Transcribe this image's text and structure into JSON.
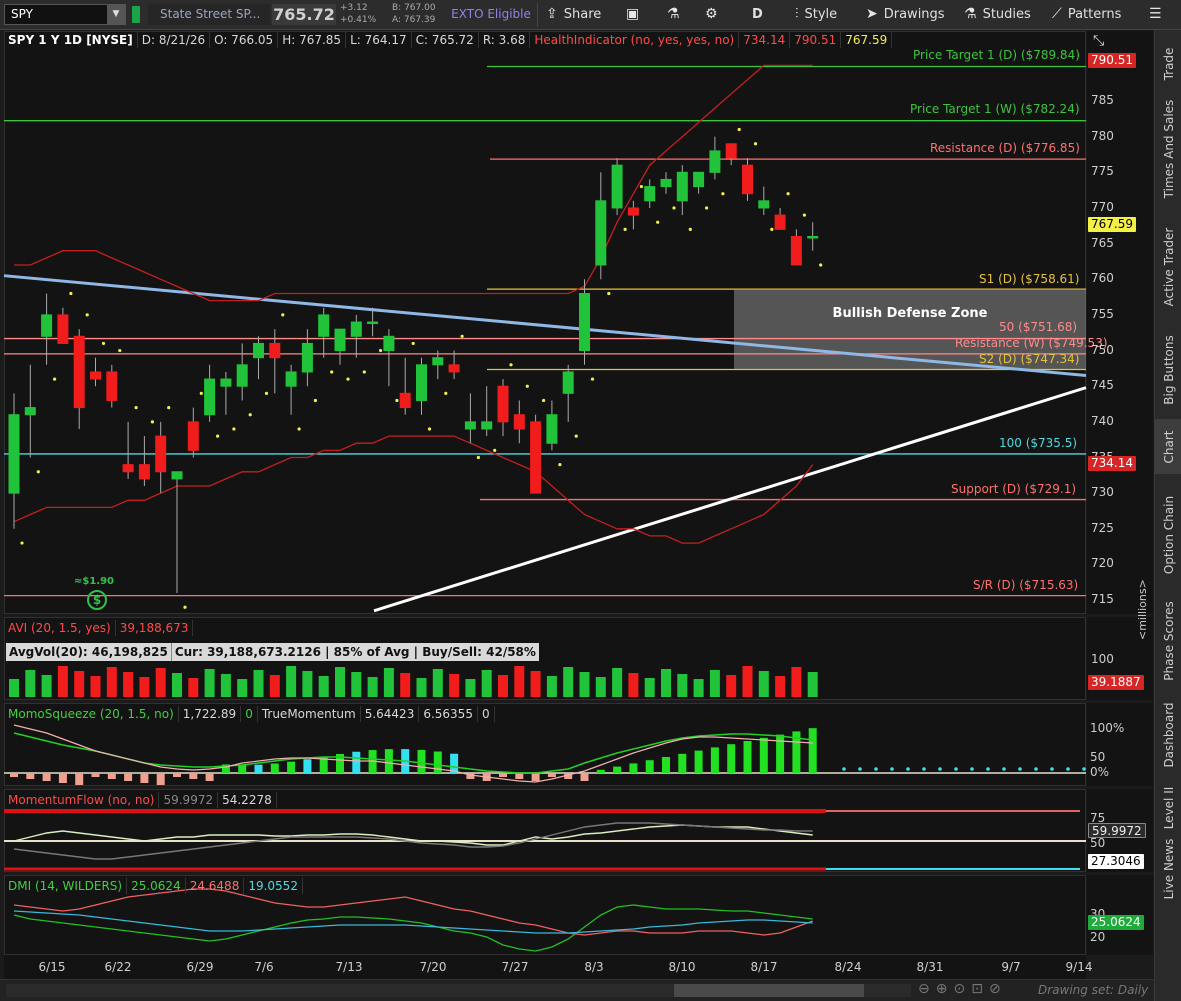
{
  "toolbar": {
    "symbol": "SPY",
    "name": "State Street SP...",
    "last": "765.72",
    "change": "+3.12",
    "change_pct": "+0.41%",
    "bid": "B: 767.00",
    "ask": "A: 767.39",
    "exto": "EXTO Eligible",
    "share": "Share",
    "timeframe": "D",
    "style": "Style",
    "drawings": "Drawings",
    "studies": "Studies",
    "patterns": "Patterns"
  },
  "header": {
    "title": "SPY 1 Y 1D [NYSE]",
    "date": "D: 8/21/26",
    "open": "O: 766.05",
    "high": "H: 767.85",
    "low": "L: 764.17",
    "close": "C: 765.72",
    "range": "R: 3.68",
    "health": "HealthIndicator (no, yes, yes, no)",
    "health_v1": "734.14",
    "health_v2": "790.51",
    "health_v3": "767.59"
  },
  "price_axis": [
    "785",
    "780",
    "775",
    "770",
    "765",
    "760",
    "755",
    "750",
    "745",
    "740",
    "735",
    "730",
    "725",
    "720",
    "715"
  ],
  "levels": {
    "pt_d": "Price Target 1 (D) ($789.84)",
    "pt_w": "Price Target 1 (W) ($782.24)",
    "res_d": "Resistance (D) ($776.85)",
    "s1_d": "S1 (D) ($758.61)",
    "defense": "Bullish Defense Zone",
    "fifty": "50 ($751.68)",
    "res_w": "Resistance (W) ($749.53)",
    "s2_d": "S2 (D) ($747.34)",
    "hundred": "100 ($735.5)",
    "sup_d": "Support (D) ($729.1)",
    "sr_d": "S/R (D) ($715.63)",
    "dividend": "≈$1.90",
    "dividend_icon": "$"
  },
  "badges": {
    "upper": "790.51",
    "last": "767.59",
    "lower": "734.14",
    "vol": "39.1887",
    "mf1": "59.9972",
    "mf2": "27.3046",
    "dmi": "25.0624"
  },
  "volume": {
    "study": "AVI (20, 1.5, yes)",
    "study_val": "39,188,673",
    "stats": "AvgVol(20): 46,198,825",
    "cur": "Cur: 39,188,673.2126 | 85% of Avg | Buy/Sell: 42/58%",
    "axis_100": "100",
    "unit": "<millions>"
  },
  "momo": {
    "study": "MomoSqueeze (20, 1.5, no)",
    "v1": "1,722.89",
    "v2": "0",
    "study2": "TrueMomentum",
    "v3": "5.64423",
    "v4": "6.56355",
    "v5": "0",
    "axis": [
      "100%",
      "50",
      "0%"
    ]
  },
  "mflow": {
    "study": "MomentumFlow (no, no)",
    "v1": "59.9972",
    "v2": "54.2278",
    "axis": [
      "75",
      "50"
    ]
  },
  "dmi": {
    "study": "DMI (14, WILDERS)",
    "v1": "25.0624",
    "v2": "24.6488",
    "v3": "19.0552",
    "axis": [
      "30",
      "20"
    ]
  },
  "dates": [
    "6/15",
    "6/22",
    "6/29",
    "7/6",
    "7/13",
    "7/20",
    "7/27",
    "8/3",
    "8/10",
    "8/17",
    "8/24",
    "8/31",
    "9/7",
    "9/14"
  ],
  "right_tabs": [
    "Trade",
    "Times And Sales",
    "Active Trader",
    "Big Buttons",
    "Chart",
    "Option Chain",
    "Phase Scores",
    "Dashboard",
    "Level II",
    "Live News"
  ],
  "footer": {
    "drawing_set": "Drawing set: Daily"
  },
  "candles": [
    {
      "d": "6/11",
      "o": 730,
      "h": 744,
      "l": 725,
      "c": 741
    },
    {
      "d": "6/12",
      "o": 741,
      "h": 748,
      "l": 735,
      "c": 742
    },
    {
      "d": "6/15",
      "o": 752,
      "h": 758,
      "l": 748,
      "c": 755
    },
    {
      "d": "6/16",
      "o": 755,
      "h": 756,
      "l": 751,
      "c": 751
    },
    {
      "d": "6/17",
      "o": 752,
      "h": 753,
      "l": 739,
      "c": 742
    },
    {
      "d": "6/18",
      "o": 747,
      "h": 749,
      "l": 745,
      "c": 746
    },
    {
      "d": "6/19",
      "o": 747,
      "h": 748,
      "l": 742,
      "c": 743
    },
    {
      "d": "6/22",
      "o": 734,
      "h": 740,
      "l": 732,
      "c": 733
    },
    {
      "d": "6/23",
      "o": 734,
      "h": 738,
      "l": 731,
      "c": 732
    },
    {
      "d": "6/24",
      "o": 738,
      "h": 740,
      "l": 730,
      "c": 733
    },
    {
      "d": "6/25",
      "o": 732,
      "h": 733,
      "l": 716,
      "c": 733
    },
    {
      "d": "6/26",
      "o": 740,
      "h": 742,
      "l": 735,
      "c": 736
    },
    {
      "d": "6/29",
      "o": 741,
      "h": 748,
      "l": 740,
      "c": 746
    },
    {
      "d": "6/30",
      "o": 745,
      "h": 747,
      "l": 741,
      "c": 746
    },
    {
      "d": "7/1",
      "o": 745,
      "h": 751,
      "l": 743,
      "c": 748
    },
    {
      "d": "7/2",
      "o": 749,
      "h": 752,
      "l": 746,
      "c": 751
    },
    {
      "d": "7/6",
      "o": 751,
      "h": 753,
      "l": 744,
      "c": 749
    },
    {
      "d": "7/7",
      "o": 745,
      "h": 748,
      "l": 741,
      "c": 747
    },
    {
      "d": "7/8",
      "o": 747,
      "h": 753,
      "l": 745,
      "c": 751
    },
    {
      "d": "7/9",
      "o": 752,
      "h": 756,
      "l": 749,
      "c": 755
    },
    {
      "d": "7/10",
      "o": 750,
      "h": 753,
      "l": 748,
      "c": 753
    },
    {
      "d": "7/13",
      "o": 752,
      "h": 755,
      "l": 749,
      "c": 754
    },
    {
      "d": "7/14",
      "o": 754,
      "h": 756,
      "l": 752,
      "c": 754
    },
    {
      "d": "7/15",
      "o": 750,
      "h": 753,
      "l": 745,
      "c": 752
    },
    {
      "d": "7/16",
      "o": 744,
      "h": 749,
      "l": 741,
      "c": 742
    },
    {
      "d": "7/17",
      "o": 743,
      "h": 749,
      "l": 741,
      "c": 748
    },
    {
      "d": "7/20",
      "o": 748,
      "h": 750,
      "l": 746,
      "c": 749
    },
    {
      "d": "7/21",
      "o": 748,
      "h": 750,
      "l": 746,
      "c": 747
    },
    {
      "d": "7/22",
      "o": 739,
      "h": 744,
      "l": 737,
      "c": 740
    },
    {
      "d": "7/23",
      "o": 739,
      "h": 745,
      "l": 738,
      "c": 740
    },
    {
      "d": "7/24",
      "o": 745,
      "h": 746,
      "l": 738,
      "c": 740
    },
    {
      "d": "7/27",
      "o": 741,
      "h": 743,
      "l": 737,
      "c": 739
    },
    {
      "d": "7/28",
      "o": 740,
      "h": 741,
      "l": 730,
      "c": 730
    },
    {
      "d": "7/29",
      "o": 737,
      "h": 743,
      "l": 736,
      "c": 741
    },
    {
      "d": "7/30",
      "o": 744,
      "h": 748,
      "l": 740,
      "c": 747
    },
    {
      "d": "7/31",
      "o": 750,
      "h": 760,
      "l": 748,
      "c": 758
    },
    {
      "d": "8/3",
      "o": 762,
      "h": 775,
      "l": 760,
      "c": 771
    },
    {
      "d": "8/4",
      "o": 770,
      "h": 777,
      "l": 769,
      "c": 776
    },
    {
      "d": "8/5",
      "o": 770,
      "h": 771,
      "l": 767,
      "c": 769
    },
    {
      "d": "8/6",
      "o": 771,
      "h": 774,
      "l": 770,
      "c": 773
    },
    {
      "d": "8/7",
      "o": 773,
      "h": 775,
      "l": 772,
      "c": 774
    },
    {
      "d": "8/10",
      "o": 771,
      "h": 776,
      "l": 769,
      "c": 775
    },
    {
      "d": "8/11",
      "o": 773,
      "h": 775,
      "l": 772,
      "c": 775
    },
    {
      "d": "8/12",
      "o": 775,
      "h": 780,
      "l": 774,
      "c": 778
    },
    {
      "d": "8/13",
      "o": 779,
      "h": 779,
      "l": 776,
      "c": 777
    },
    {
      "d": "8/14",
      "o": 776,
      "h": 777,
      "l": 771,
      "c": 772
    },
    {
      "d": "8/17",
      "o": 770,
      "h": 773,
      "l": 769,
      "c": 771
    },
    {
      "d": "8/18",
      "o": 769,
      "h": 770,
      "l": 767,
      "c": 767
    },
    {
      "d": "8/19",
      "o": 766,
      "h": 767,
      "l": 762,
      "c": 762
    },
    {
      "d": "8/21",
      "o": 766,
      "h": 768,
      "l": 764,
      "c": 766
    }
  ]
}
